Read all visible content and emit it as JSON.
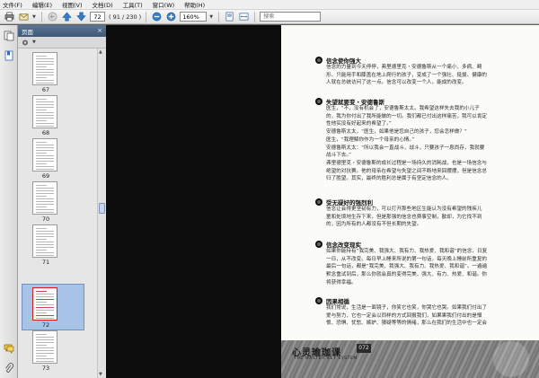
{
  "menu": [
    "文件(F)",
    "编辑(E)",
    "视图(V)",
    "文档(D)",
    "工具(T)",
    "窗口(W)",
    "帮助(H)"
  ],
  "toolbar": {
    "current_page": "72",
    "page_count": "( 91 / 230 )",
    "zoom": "160%",
    "search_placeholder": "搜索"
  },
  "panel": {
    "title": "页面",
    "close": "×"
  },
  "thumbnails": [
    {
      "label": "67",
      "selected": false
    },
    {
      "label": "68",
      "selected": false
    },
    {
      "label": "69",
      "selected": false
    },
    {
      "label": "70",
      "selected": false
    },
    {
      "label": "71",
      "selected": false
    },
    {
      "label": "72",
      "selected": true
    },
    {
      "label": "73",
      "selected": false
    }
  ],
  "page": {
    "sections": [
      {
        "title": "信念使你强大",
        "lines": [
          "信念的力量到今天停停，弗里德里克・安德鲁斯从一个痛小、多病、畸",
          "形、只能用手和膝盖在地上爬行的孩子，变成了一个强壮、挺拔、健康的",
          "人就在总统访问了这一点。信念可以改变一个人，能成的改变。"
        ]
      },
      {
        "title": "失望就要变・安德鲁斯",
        "lines": [
          "医生，“不，没有机会了，安德鲁斯太太。我希望这样失去我的小儿子",
          "的，我为你付出了我所能做的一切。我们都已付出这样痛苦，我可以肯定",
          "性他实没有好起来的希望了。”",
          "安德鲁斯太太，“医生，如果他是您自己的孩子，您会怎样做？”",
          "医生，“我理解你作为一个母亲的心情。”",
          "安德鲁斯太太：“所以我会一直战斗，战斗，只要孩子一息尚存，我就要",
          "战斗下去。”",
          "弗里德里克・安德鲁斯的成长过程是一场持久的消耗战，也是一场信念与",
          "绝望的对抗赛。他的母亲在希望与失望之间不断地来回摆摆，但是信念总",
          "归了胜望。其实，最终的胜利总是属于有坚定信念的人。"
        ]
      },
      {
        "title": "受无疑好的强烈利",
        "lines": [
          "信念让会得更坚韧有力，可以打开那些地区生能认为没有希望的残疾儿",
          "童和处境地生存下来，但是那强的信念也费事空制，散却，为它找不到",
          "的，因为所有的人都没有不但长期的失望。"
        ]
      },
      {
        "title": "信念改变现实",
        "lines": [
          "如果你能持有“我完美、我强大、我有力、我热爱、我和谐”的信念，日复",
          "一日，从不改变。每日早上睡来所说的第一句话，每天晚上睡前所重复的",
          "最后一句话，都是“我完美、我强大、我有力、我热爱、我和谐”。一遍遍",
          "默念重试到后，那么你就会真的变得完美、强大、有力、热爱、和谐。你",
          "将获得幸福。"
        ]
      },
      {
        "title": "因果相循",
        "lines": [
          "我们常说，生活是一面镜子，你笑它也笑，你哭它也哭。如果我们付出了",
          "爱与努力，它也一定会以同样的方式回报我们，如果果我们付出的是憎",
          "恨、恐惧、忧愁、嫉妒、猜疑等等的情绪，那么在我们的生活中也一定会"
        ]
      }
    ],
    "footer": {
      "title": "心灵瑜珈课",
      "badge": "072",
      "subtitle": "THE MASTER KEY SYSTEM"
    }
  },
  "colors": {
    "panel_header": "#4a6484",
    "selected_border": "#d11d1d",
    "selected_bg": "#a7c4e6"
  }
}
